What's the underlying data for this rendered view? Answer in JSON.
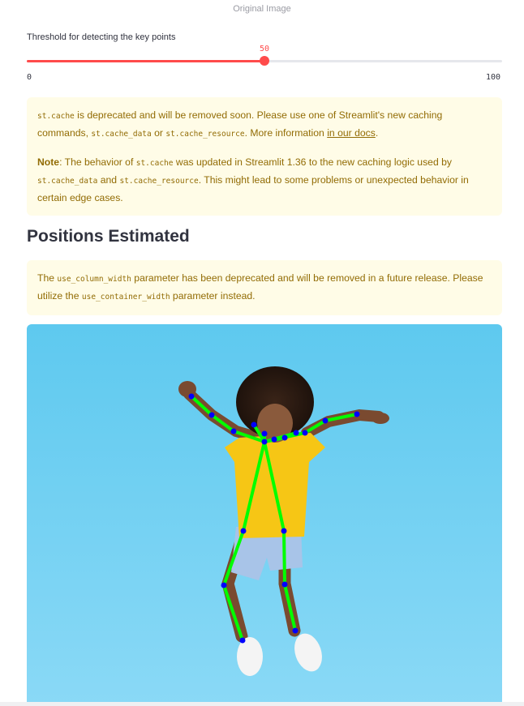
{
  "caption": "Original Image",
  "slider": {
    "label": "Threshold for detecting the key points",
    "value": 50,
    "value_text": "50",
    "min_text": "0",
    "max_text": "100",
    "accent_color": "#ff4b4b"
  },
  "alert_cache": {
    "p1": {
      "code1": "st.cache",
      "text1": " is deprecated and will be removed soon. Please use one of Streamlit's new caching commands, ",
      "code2": "st.cache_data",
      "text2": " or ",
      "code3": "st.cache_resource",
      "text3": ". More information ",
      "link": "in our docs",
      "text4": "."
    },
    "p2": {
      "bold": "Note",
      "text1": ": The behavior of ",
      "code1": "st.cache",
      "text2": " was updated in Streamlit 1.36 to the new caching logic used by ",
      "code2": "st.cache_data",
      "text3": " and ",
      "code3": "st.cache_resource",
      "text4": ". This might lead to some problems or unexpected behavior in certain edge cases."
    }
  },
  "heading": "Positions Estimated",
  "alert_width": {
    "text1": "The ",
    "code1": "use_column_width",
    "text2": " parameter has been deprecated and will be removed in a future release. Please utilize the ",
    "code2": "use_container_width",
    "text3": " parameter instead."
  },
  "colors": {
    "alert_bg": "#fffce7",
    "alert_text": "#926c05",
    "skeleton_line": "#00ff00",
    "keypoint": "#0000ff"
  }
}
